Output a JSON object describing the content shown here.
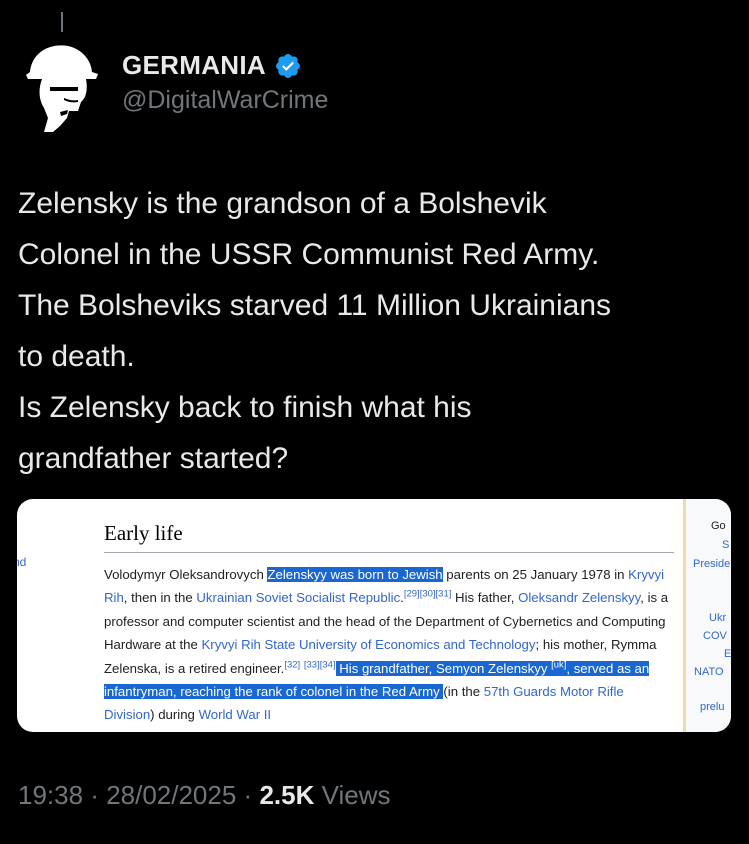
{
  "author": {
    "display_name": "GERMANIA",
    "handle": "@DigitalWarCrime"
  },
  "tweet": {
    "text": "Zelensky is the grandson of a Bolshevik\nColonel in the USSR Communist Red Army.\nThe Bolsheviks starved 11 Million Ukrainians\nto death.\nIs Zelensky back to finish what his\ngrandfather started?"
  },
  "media": {
    "left_fragment": "nd",
    "heading": "Early life",
    "p": {
      "t01": "Volodymyr Oleksandrovych ",
      "h01": "Zelenskyy was born to Jewish",
      "t02": " parents on 25 January 1978 in ",
      "l01": "Kryvyi Rih",
      "t03": ", then in the ",
      "l02": "Ukrainian Soviet Socialist Republic",
      "t04": ".",
      "s01": "[29][30][31]",
      "t05": " His father, ",
      "l03": "Oleksandr Zelenskyy",
      "t06": ", is a professor and computer scientist and the head of the Department of Cybernetics and Computing Hardware at the ",
      "l04": "Kryvyi Rih State University of Economics and Technology",
      "t07": "; his mother, Rymma Zelenska, is a retired engineer.",
      "s02": "[32]",
      "s03": "[33][34]",
      "h02": " His grandfather, Semyon Zelenskyy ",
      "h03": "[uk]",
      "h04": ", served as an infantryman, reaching the rank of colonel in the Red Army ",
      "t08": "(in the ",
      "l05": "57th Guards Motor Rifle Division",
      "t09": ") during ",
      "l06": "World War II"
    },
    "sidebar": {
      "line1": "Go",
      "line2": "S",
      "line3": "Preside",
      "line4": "Ukr",
      "line5": "COV",
      "line6": "E",
      "line7": "NATO",
      "line8": "prelu"
    }
  },
  "meta": {
    "time": "19:38",
    "sep1": " · ",
    "date": "28/02/2025",
    "sep2": " · ",
    "views_count": "2.5K",
    "views_label": " Views"
  },
  "colors": {
    "background": "#000000",
    "text": "#e7e9ea",
    "muted": "#71767b",
    "verified": "#1d9bf0",
    "wiki_link": "#3366cc",
    "wiki_highlight": "#1967d2"
  }
}
